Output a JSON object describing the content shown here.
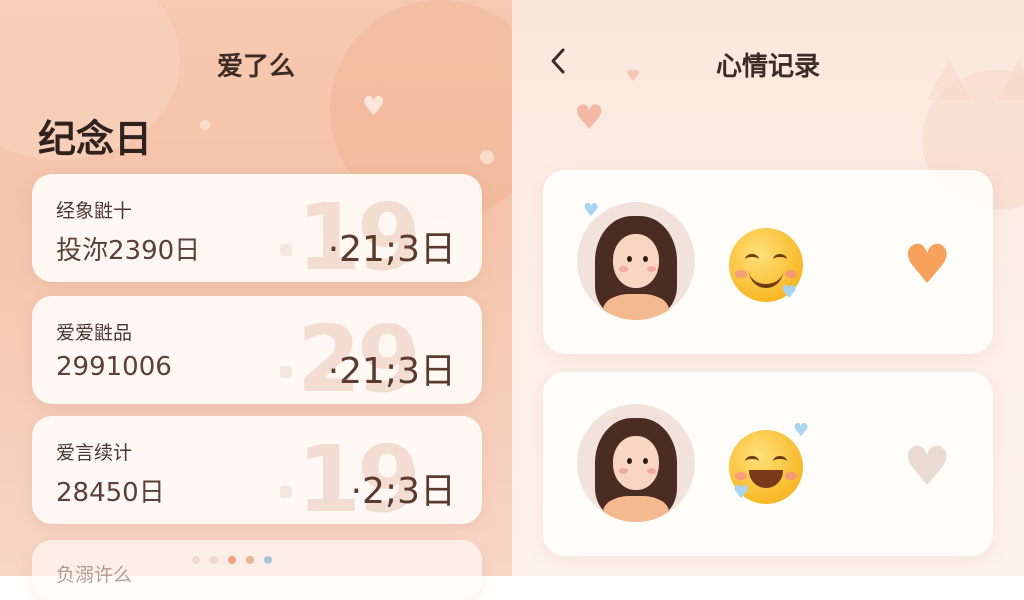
{
  "left_panel": {
    "app_title": "爱了么",
    "section_title": "纪念日",
    "cards": [
      {
        "name": "经象鼪十",
        "days": "投沵2390日",
        "bg_number": "19",
        "countdown": "·21;3日"
      },
      {
        "name": "爱爱鼪品",
        "days": "2991006",
        "bg_number": "29",
        "countdown": "·21;3日"
      },
      {
        "name": "爱言续计",
        "days": "28450日",
        "bg_number": "19",
        "countdown": "·2;3日"
      },
      {
        "name": "负溺许么",
        "days": "",
        "bg_number": "",
        "countdown": ""
      }
    ],
    "pager_colors": [
      "#f4d8ca",
      "#f4d8ca",
      "#f0a080",
      "#e9b48f",
      "#a9c3d4"
    ]
  },
  "right_panel": {
    "back_icon": "chevron-left-icon",
    "title": "心情记录",
    "moods": [
      {
        "avatar": "girl-avatar",
        "emoji": "smiling-face-emoji",
        "heart_icon": "heart-icon",
        "heart_color": "#f7a15c",
        "liked": true
      },
      {
        "avatar": "girl-avatar",
        "emoji": "grinning-face-emoji",
        "heart_icon": "heart-icon",
        "heart_color": "#eadbd2",
        "liked": false
      }
    ]
  }
}
